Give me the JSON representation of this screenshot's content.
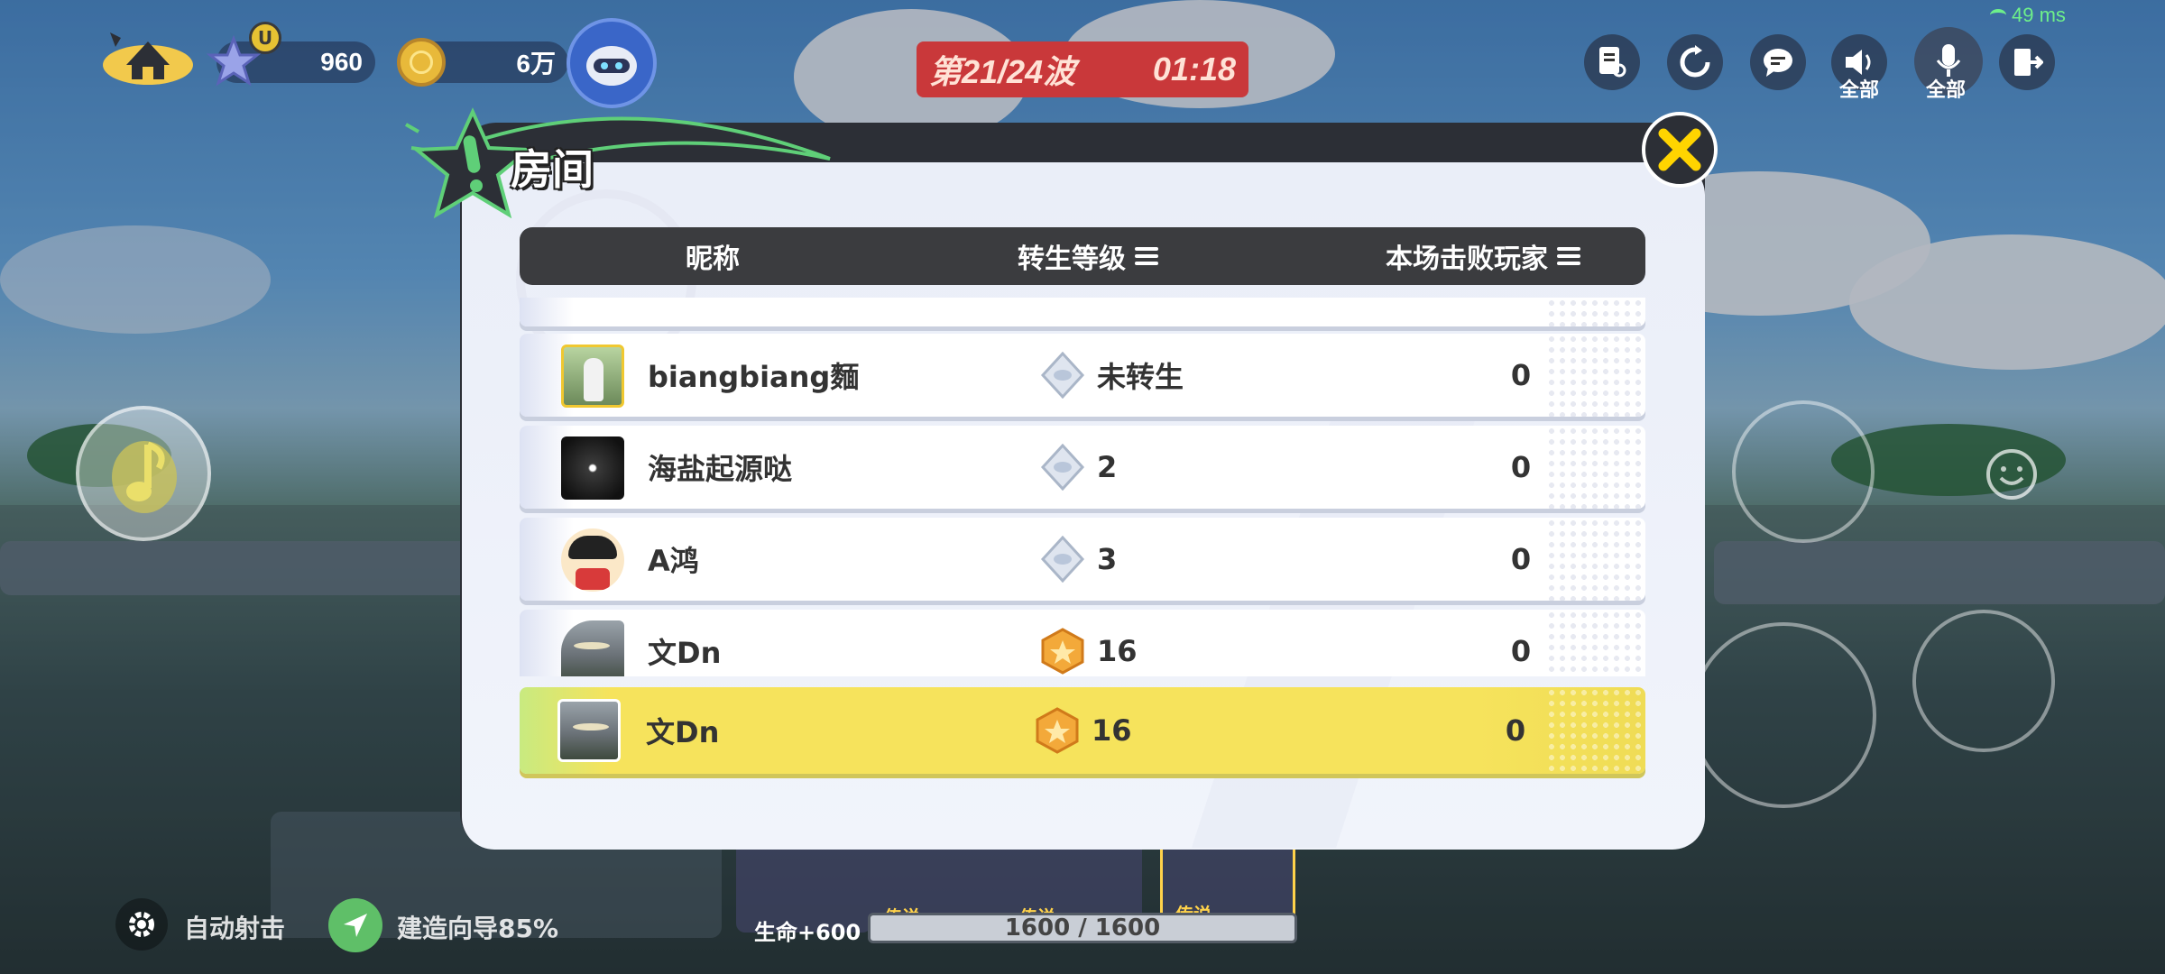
{
  "hud": {
    "stars": "960",
    "coins": "6万",
    "star_badge": "U",
    "ping": "49 ms"
  },
  "wave": {
    "label": "第21/24波",
    "timer": "01:18"
  },
  "top_right": {
    "speaker_label": "全部",
    "mic_label": "全部"
  },
  "room": {
    "title": "房间",
    "columns": {
      "nickname": "昵称",
      "rebirth_level": "转生等级",
      "defeated": "本场击败玩家"
    },
    "rows": [
      {
        "name": "biangbiang麵",
        "level": "未转生",
        "kills": "0",
        "badge": "silver"
      },
      {
        "name": "海盐起源哒",
        "level": "2",
        "kills": "0",
        "badge": "silver"
      },
      {
        "name": "A鸿",
        "level": "3",
        "kills": "0",
        "badge": "silver"
      },
      {
        "name": "文Dn",
        "level": "16",
        "kills": "0",
        "badge": "gold"
      }
    ],
    "self": {
      "name": "文Dn",
      "level": "16",
      "kills": "0",
      "badge": "gold"
    }
  },
  "bottom": {
    "auto_fire": "自动射击",
    "build_guide": "建造向导85%",
    "life": "生命+600",
    "hp": "1600 / 1600",
    "card_label": "传说"
  },
  "colors": {
    "wave_bg": "#c9383a",
    "self_row": "#f6e35c",
    "header_bg": "#3b3c3f",
    "title_star": "#2c2f36",
    "close_x": "#ffd400"
  }
}
